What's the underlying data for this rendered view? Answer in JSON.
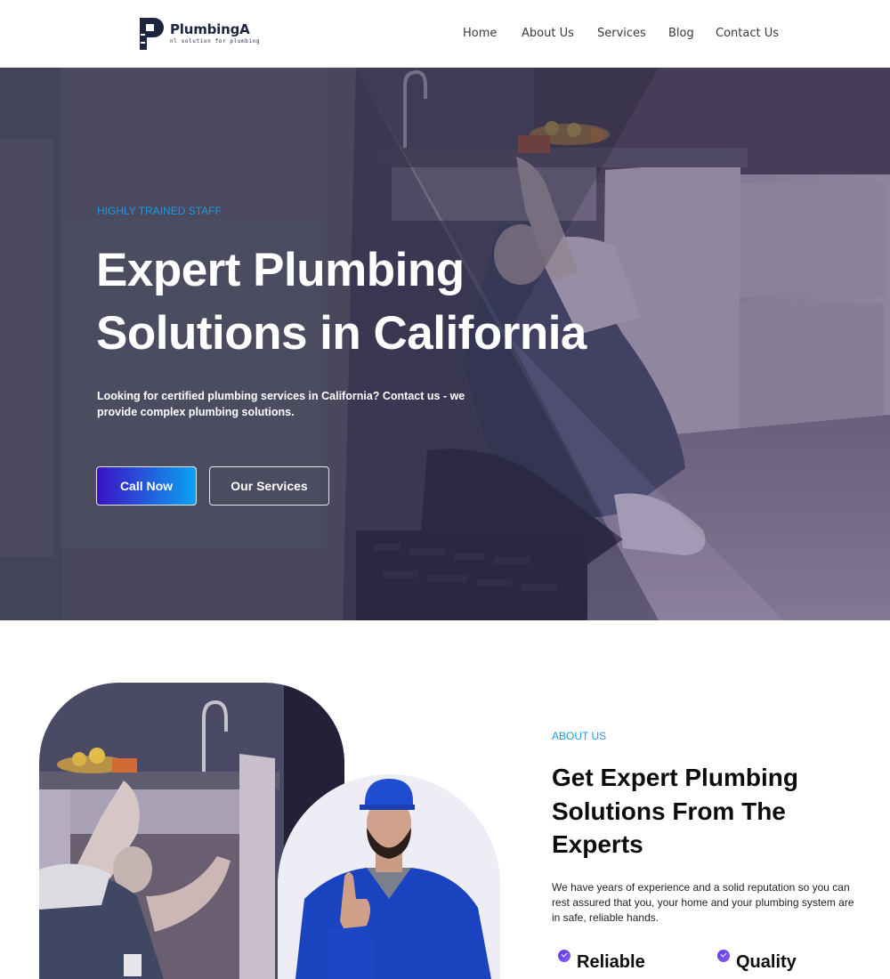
{
  "brand": {
    "name": "PlumbingA",
    "tagline": "nl solution for plumbing"
  },
  "nav": {
    "items": [
      {
        "label": "Home"
      },
      {
        "label": "About Us"
      },
      {
        "label": "Services"
      },
      {
        "label": "Blog"
      },
      {
        "label": "Contact Us"
      }
    ]
  },
  "hero": {
    "eyebrow": "HIGHLY TRAINED STAFF",
    "title_line1": "Expert Plumbing",
    "title_line2": "Solutions in California",
    "description": "Looking for certified plumbing services in California? Contact us - we provide complex plumbing solutions.",
    "primary_button": "Call Now",
    "secondary_button": "Our Services",
    "image_alt": "plumber working under kitchen sink"
  },
  "about": {
    "eyebrow": "ABOUT US",
    "title": "Get Expert Plumbing Solutions From The Experts",
    "description": "We have years of experience and a solid reputation so you can rest assured that you, your home and your plumbing system are in safe, reliable hands.",
    "features": [
      {
        "label": "Reliable"
      },
      {
        "label": "Quality"
      }
    ],
    "image1_alt": "plumber fixing pipe under sink",
    "image2_alt": "smiling plumber giving thumbs up"
  },
  "colors": {
    "accent_blue": "#1a9be8",
    "gradient_start": "#3a12c4",
    "gradient_end": "#0ba2f2",
    "brand_navy": "#1e2540",
    "check_purple": "#6a45e6"
  }
}
